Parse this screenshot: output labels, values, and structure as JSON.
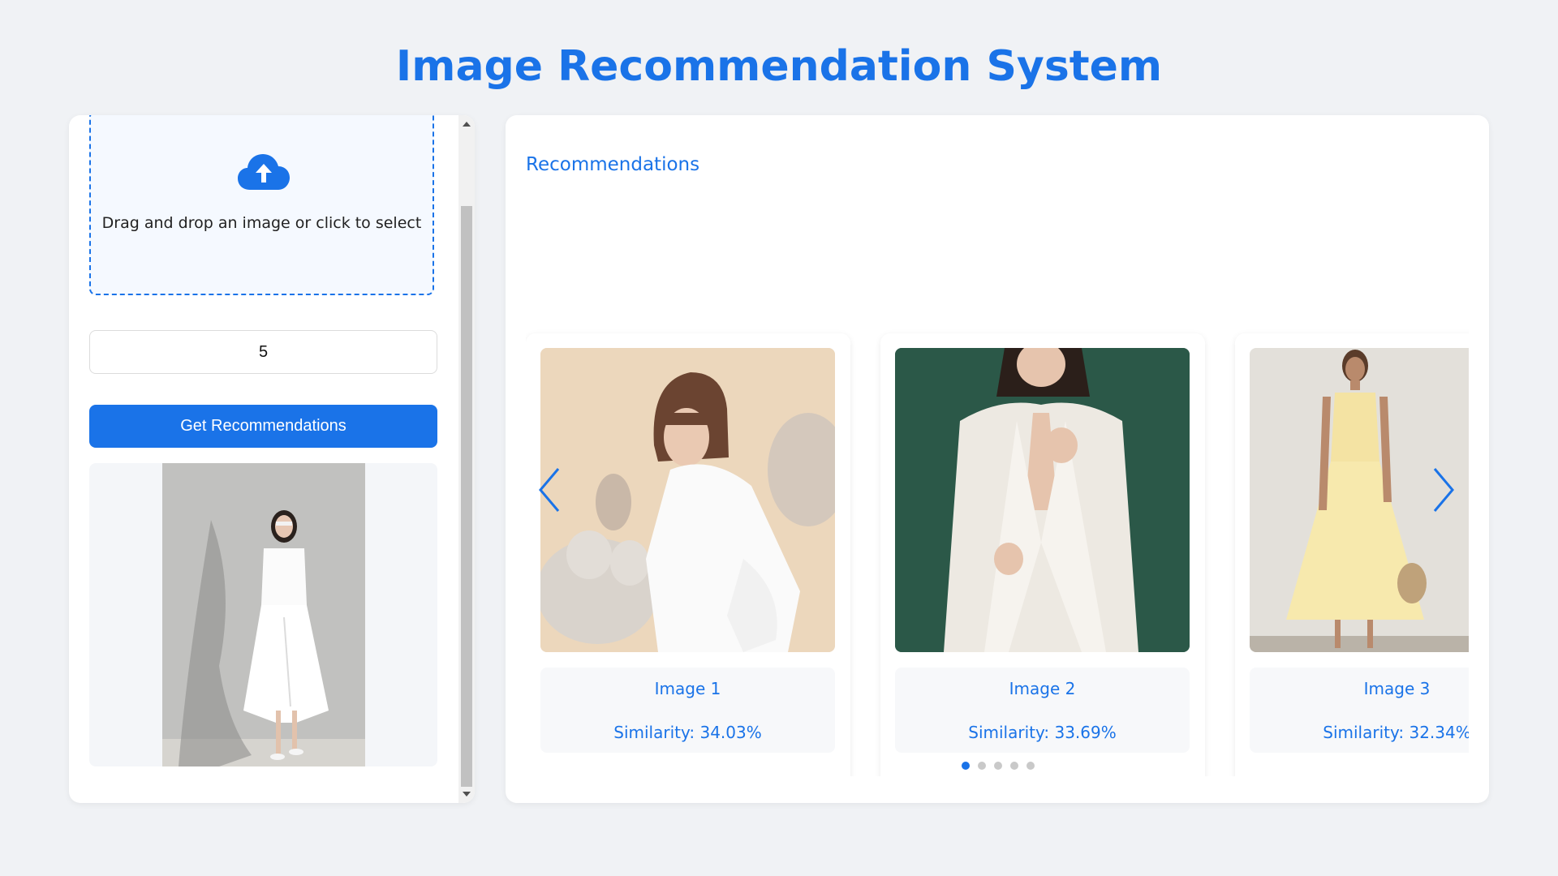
{
  "page": {
    "title": "Image Recommendation System"
  },
  "upload": {
    "icon": "cloud-upload-icon",
    "prompt": "Drag and drop an image or click to select"
  },
  "count_input": {
    "value": "5"
  },
  "get_button": {
    "label": "Get Recommendations"
  },
  "recommendations": {
    "title": "Recommendations",
    "items": [
      {
        "name": "Image 1",
        "similarity": "Similarity: 34.03%"
      },
      {
        "name": "Image 2",
        "similarity": "Similarity: 33.69%"
      },
      {
        "name": "Image 3",
        "similarity": "Similarity: 32.34%"
      }
    ],
    "dots_count": 5,
    "active_dot": 0
  },
  "colors": {
    "accent": "#1a73e8",
    "background": "#f0f2f5",
    "dropzone_bg": "#f5f9ff"
  }
}
